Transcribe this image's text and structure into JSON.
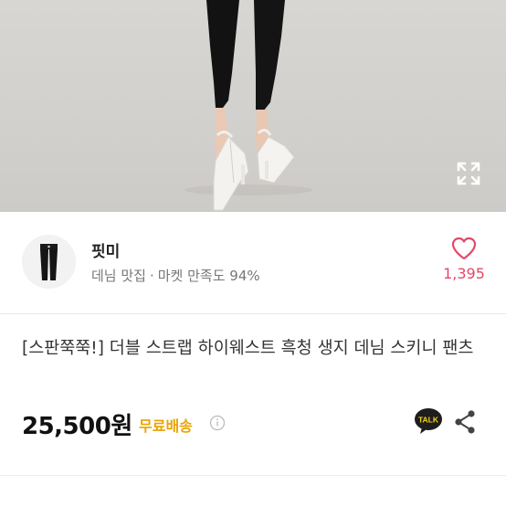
{
  "photo": {
    "expand_icon": "expand-icon"
  },
  "seller": {
    "name": "핏미",
    "category": "데님 맛집",
    "separator": "·",
    "satisfaction": "마켓 만족도 94%",
    "like_icon": "heart-outline-icon",
    "like_count": "1,395"
  },
  "product": {
    "title": "[스판쭉쭉!] 더블 스트랩 하이웨스트 흑청 생지 데님 스키니 팬츠",
    "price": "25,500원",
    "shipping": "무료배송",
    "shipping_info_icon": "info-circle-icon",
    "talk_label": "TALK",
    "share_icon": "share-icon"
  },
  "colors": {
    "accent_pink": "#e4486a",
    "shipping_yellow": "#e8a400",
    "talk_yellow": "#f7d31a"
  }
}
